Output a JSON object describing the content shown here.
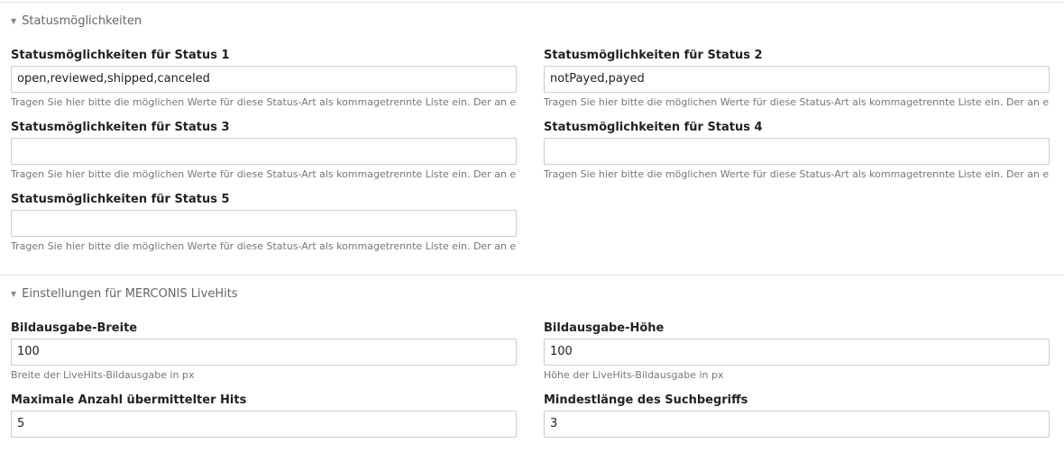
{
  "section_status": {
    "title": "Statusmöglichkeiten",
    "fields": [
      {
        "label": "Statusmöglichkeiten für Status 1",
        "value": "open,reviewed,shipped,canceled",
        "help": "Tragen Sie hier bitte die möglichen Werte für diese Status-Art als kommagetrennte Liste ein. Der an erster"
      },
      {
        "label": "Statusmöglichkeiten für Status 2",
        "value": "notPayed,payed",
        "help": "Tragen Sie hier bitte die möglichen Werte für diese Status-Art als kommagetrennte Liste ein. Der an erster"
      },
      {
        "label": "Statusmöglichkeiten für Status 3",
        "value": "",
        "help": "Tragen Sie hier bitte die möglichen Werte für diese Status-Art als kommagetrennte Liste ein. Der an erster"
      },
      {
        "label": "Statusmöglichkeiten für Status 4",
        "value": "",
        "help": "Tragen Sie hier bitte die möglichen Werte für diese Status-Art als kommagetrennte Liste ein. Der an erster"
      },
      {
        "label": "Statusmöglichkeiten für Status 5",
        "value": "",
        "help": "Tragen Sie hier bitte die möglichen Werte für diese Status-Art als kommagetrennte Liste ein. Der an erster"
      }
    ]
  },
  "section_livehits": {
    "title": "Einstellungen für MERCONIS LiveHits",
    "fields": [
      {
        "label": "Bildausgabe-Breite",
        "value": "100",
        "help": "Breite der LiveHits-Bildausgabe in px"
      },
      {
        "label": "Bildausgabe-Höhe",
        "value": "100",
        "help": "Höhe der LiveHits-Bildausgabe in px"
      },
      {
        "label": "Maximale Anzahl übermittelter Hits",
        "value": "5"
      },
      {
        "label": "Mindestlänge des Suchbegriffs",
        "value": "3"
      }
    ]
  },
  "icons": {
    "collapse": "triangle-down-icon"
  }
}
